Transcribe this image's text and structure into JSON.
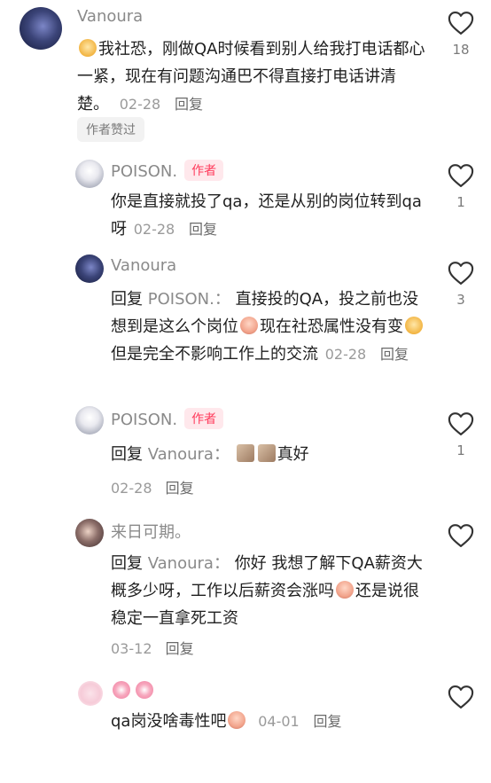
{
  "comments": [
    {
      "user": "Vanoura",
      "text": "我社恐，刚做QA时候看到别人给我打电话都心一紧，现在有问题沟通巴不得直接打电话讲清楚。",
      "date": "02-28",
      "reply_label": "回复",
      "author_liked": "作者赞过",
      "likes": "18",
      "avatar_icon": "avatar-icon",
      "emoji": "smile-emoji"
    },
    {
      "user": "POISON.",
      "badge": "作者",
      "text": "你是直接就投了qa，还是从别的岗位转到qa呀",
      "date": "02-28",
      "reply_label": "回复",
      "likes": "1"
    },
    {
      "user": "Vanoura",
      "reply_prefix": "回复",
      "reply_to": "POISON.：",
      "text_1": "直接投的QA，投之前也没想到是这么个岗位",
      "text_2": "现在社恐属性没有变",
      "text_3": "但是完全不影响工作上的交流",
      "date": "02-28",
      "reply_label": "回复",
      "likes": "3"
    },
    {
      "user": "POISON.",
      "badge": "作者",
      "reply_prefix": "回复",
      "reply_to": "Vanoura：",
      "text": "真好",
      "date": "02-28",
      "reply_label": "回复",
      "likes": "1"
    },
    {
      "user": "来日可期。",
      "reply_prefix": "回复",
      "reply_to": "Vanoura：",
      "text_1": "你好 我想了解下QA薪资大概多少呀，工作以后薪资会涨吗",
      "text_2": "还是说很稳定一直拿死工资",
      "date": "03-12",
      "reply_label": "回复"
    },
    {
      "text": "qa岗没啥毒性吧",
      "date": "04-01",
      "reply_label": "回复"
    }
  ],
  "colors": {
    "author_badge": "#ff3b5c",
    "meta": "#9a9a9a"
  }
}
